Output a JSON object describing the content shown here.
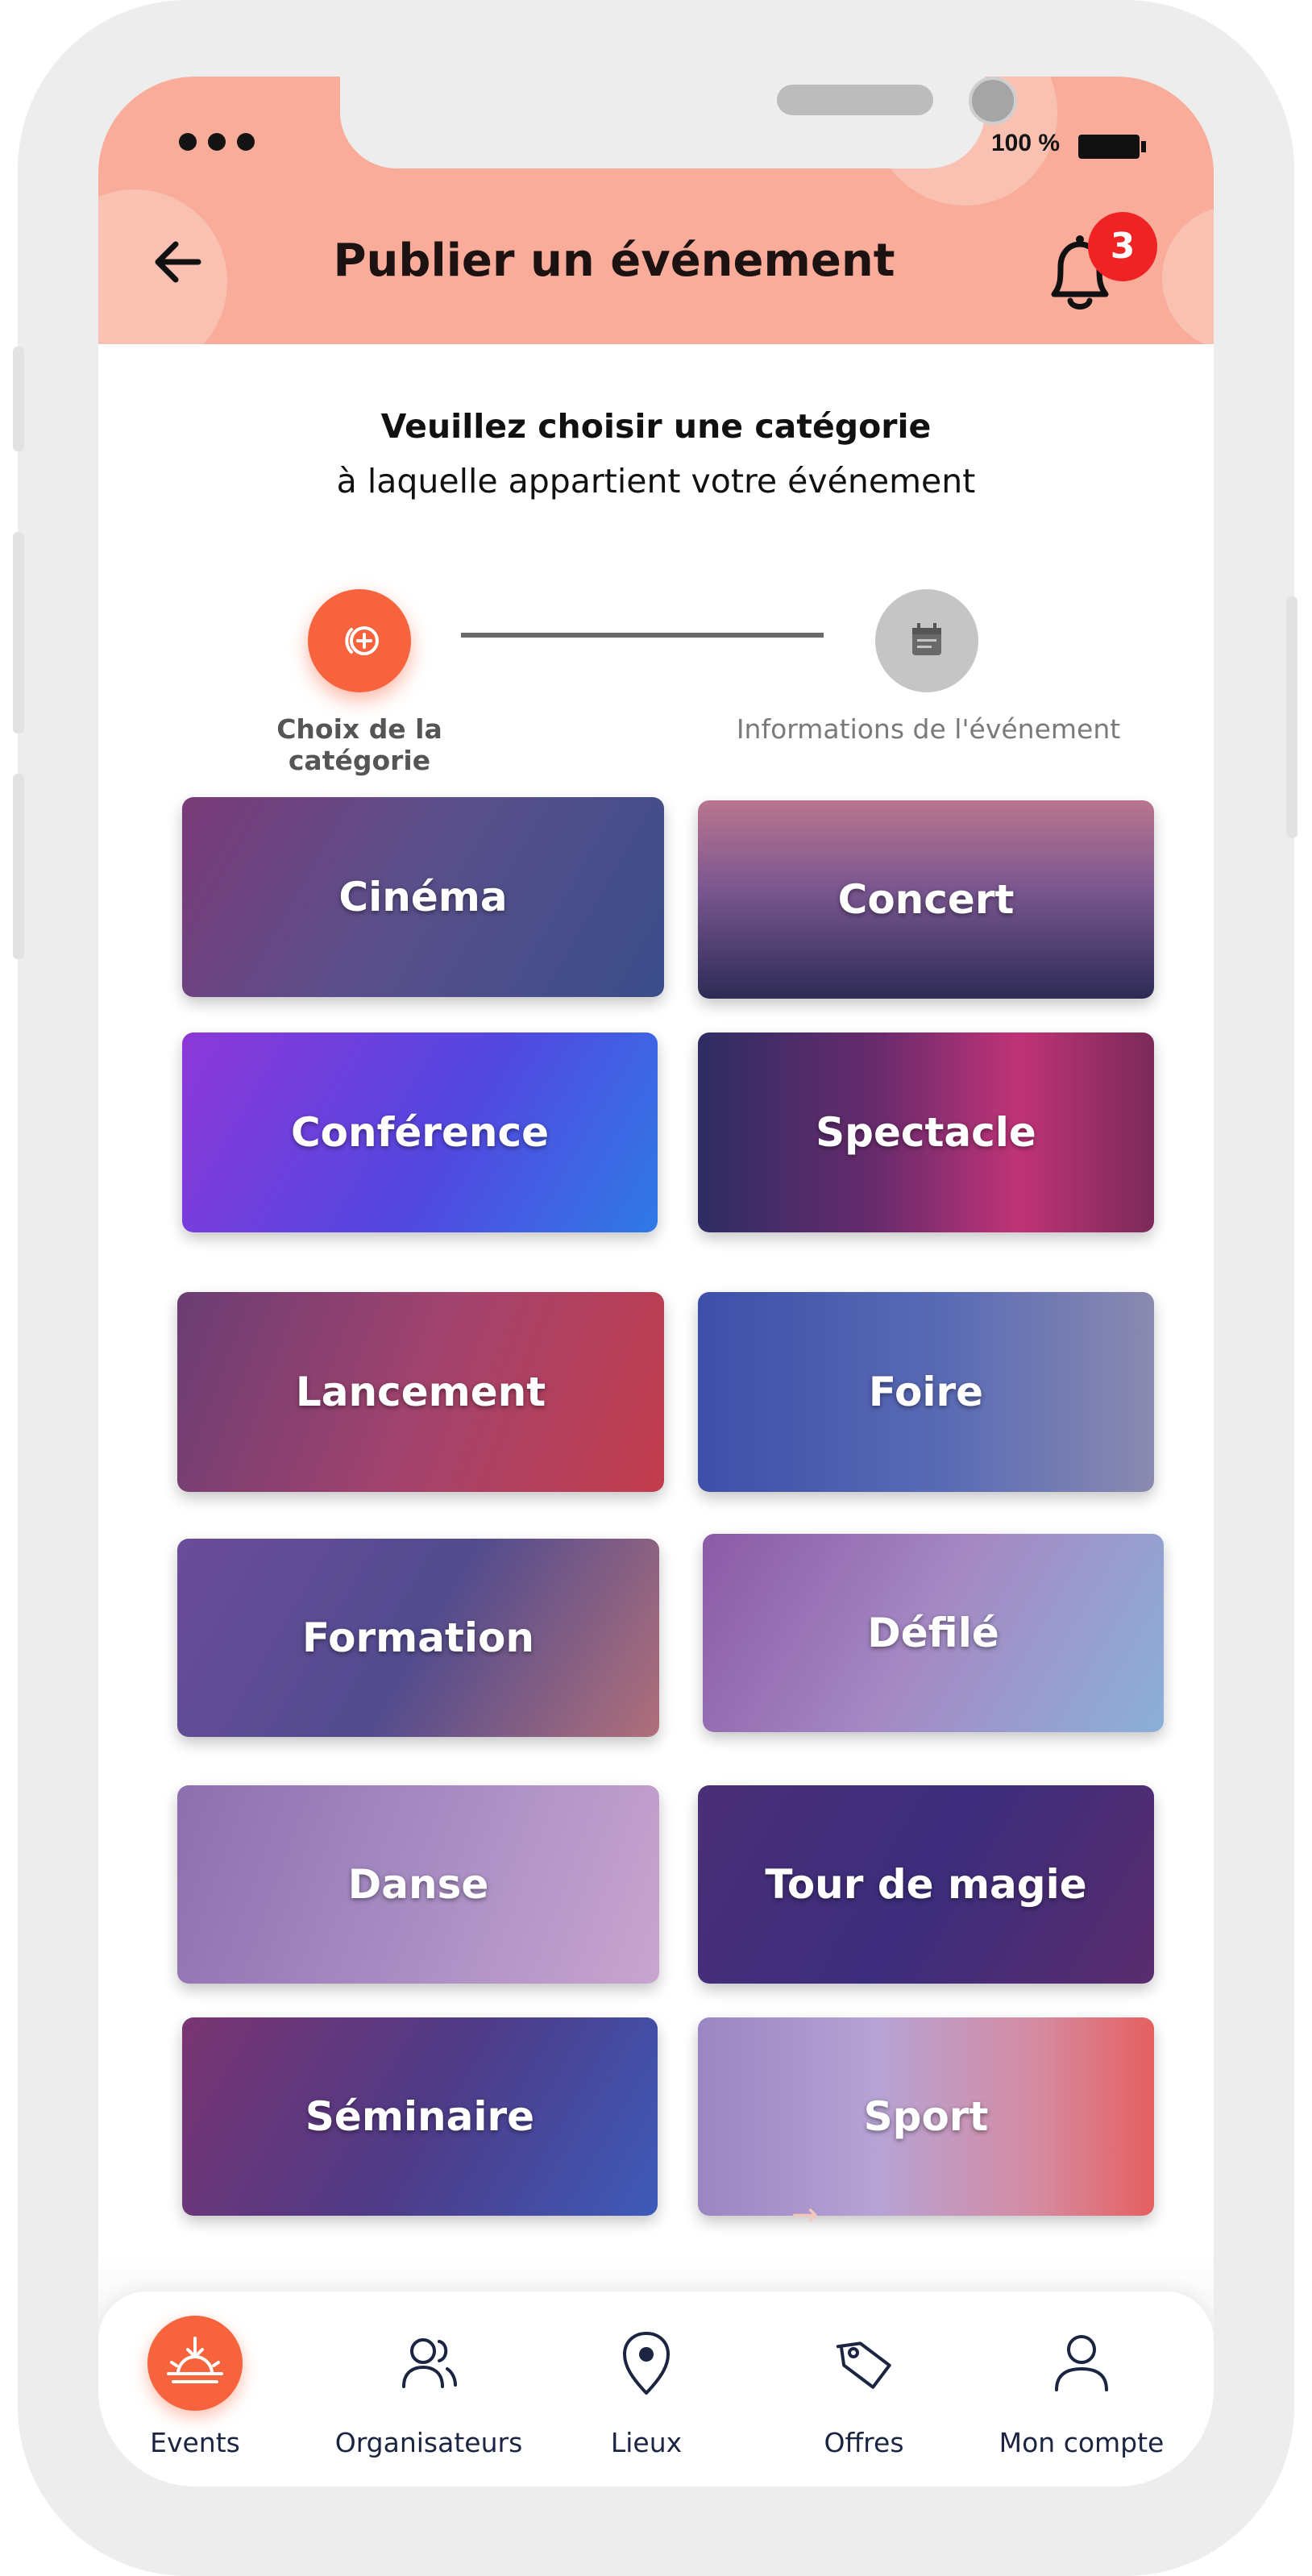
{
  "status_bar": {
    "battery": "100 %"
  },
  "header": {
    "title": "Publier un événement",
    "notification_count": "3"
  },
  "intro": {
    "line1": "Veuillez choisir une catégorie",
    "line2": "à laquelle appartient votre événement"
  },
  "steps": [
    {
      "label": "Choix de la catégorie",
      "state": "active"
    },
    {
      "label": "Informations de l'événement",
      "state": "pending"
    }
  ],
  "categories": [
    {
      "label": "Cinéma"
    },
    {
      "label": "Concert"
    },
    {
      "label": "Conférence"
    },
    {
      "label": "Spectacle"
    },
    {
      "label": "Lancement"
    },
    {
      "label": "Foire"
    },
    {
      "label": "Formation"
    },
    {
      "label": "Défilé"
    },
    {
      "label": "Danse"
    },
    {
      "label": "Tour de magie"
    },
    {
      "label": "Séminaire"
    },
    {
      "label": "Sport"
    }
  ],
  "tabbar": {
    "active": "Events",
    "items": [
      {
        "label": "Events",
        "icon": "sunrise-icon"
      },
      {
        "label": "Organisateurs",
        "icon": "users-icon"
      },
      {
        "label": "Lieux",
        "icon": "location-pin-icon"
      },
      {
        "label": "Offres",
        "icon": "tag-icon"
      },
      {
        "label": "Mon compte",
        "icon": "user-icon"
      }
    ]
  },
  "colors": {
    "header_bg": "#f8ac99",
    "accent": "#f7633d",
    "badge": "#ef2323",
    "step_pending": "#c5c5c5"
  }
}
